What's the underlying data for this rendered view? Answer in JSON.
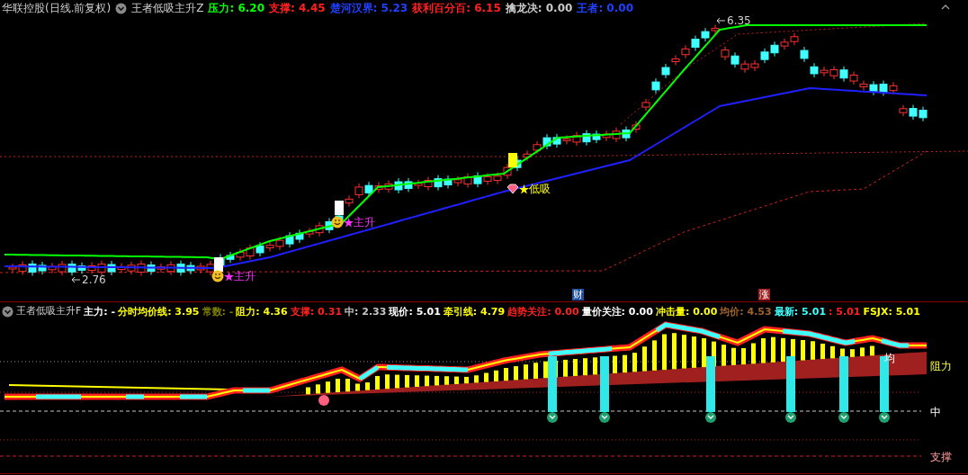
{
  "main_panel": {
    "stock_name": "华联控股(日线.前复权)",
    "indicator_name": "王者低吸主升Z",
    "legend": [
      {
        "text": "压力: 6.20",
        "color": "#00ff00"
      },
      {
        "text": "支撑: 4.45",
        "color": "#ff2020"
      },
      {
        "text": "楚河汉界: 5.23",
        "color": "#2040ff"
      },
      {
        "text": "获利百分百: 6.15",
        "color": "#ff2020"
      },
      {
        "text": "擒龙决: 0.00",
        "color": "#c8c8c8"
      },
      {
        "text": "王者: 0.00",
        "color": "#2040ff"
      }
    ],
    "price_labels": [
      {
        "kind": "high",
        "text": "6.35"
      },
      {
        "kind": "low",
        "text": "2.76"
      }
    ],
    "signals": [
      {
        "kind": "main-rise",
        "text": "主升"
      },
      {
        "kind": "main-rise",
        "text": "主升"
      },
      {
        "kind": "low-buy",
        "text": "低吸"
      }
    ],
    "date_markers": [
      {
        "kind": "finance",
        "text": "财"
      },
      {
        "kind": "limit-up",
        "text": "涨"
      }
    ]
  },
  "sub_panel": {
    "indicator_name": "王者低吸主升F",
    "legend": [
      {
        "text": "主力: -",
        "color": "#ffffff"
      },
      {
        "text": "分时均价线: 3.95",
        "color": "#ffff00"
      },
      {
        "text": "常数: -",
        "color": "#808000"
      },
      {
        "text": "阻力: 4.36",
        "color": "#ffff00"
      },
      {
        "text": "支撑: 0.31",
        "color": "#ff2020"
      },
      {
        "text": "中: 2.33",
        "color": "#c8c8c8"
      },
      {
        "text": "现价: 5.01",
        "color": "#ffffff"
      },
      {
        "text": "牵引线: 4.79",
        "color": "#ffff00"
      },
      {
        "text": "趋势关注: 0.00",
        "color": "#ff2020"
      },
      {
        "text": "量价关注: 0.00",
        "color": "#ffffff"
      },
      {
        "text": "冲击量: 0.00",
        "color": "#ffff00"
      },
      {
        "text": "均价: 4.53",
        "color": "#a0642a"
      },
      {
        "text": "最新: 5.01",
        "color": "#40ffff"
      },
      {
        "text": ": 5.01",
        "color": "#ff2020"
      },
      {
        "text": "FSJX: 5.01",
        "color": "#ffff00"
      }
    ],
    "average_marker": "均",
    "level_labels": [
      {
        "kind": "resistance",
        "text": "阻力"
      },
      {
        "kind": "middle",
        "text": "中"
      },
      {
        "kind": "support",
        "text": "支撑"
      }
    ]
  }
}
